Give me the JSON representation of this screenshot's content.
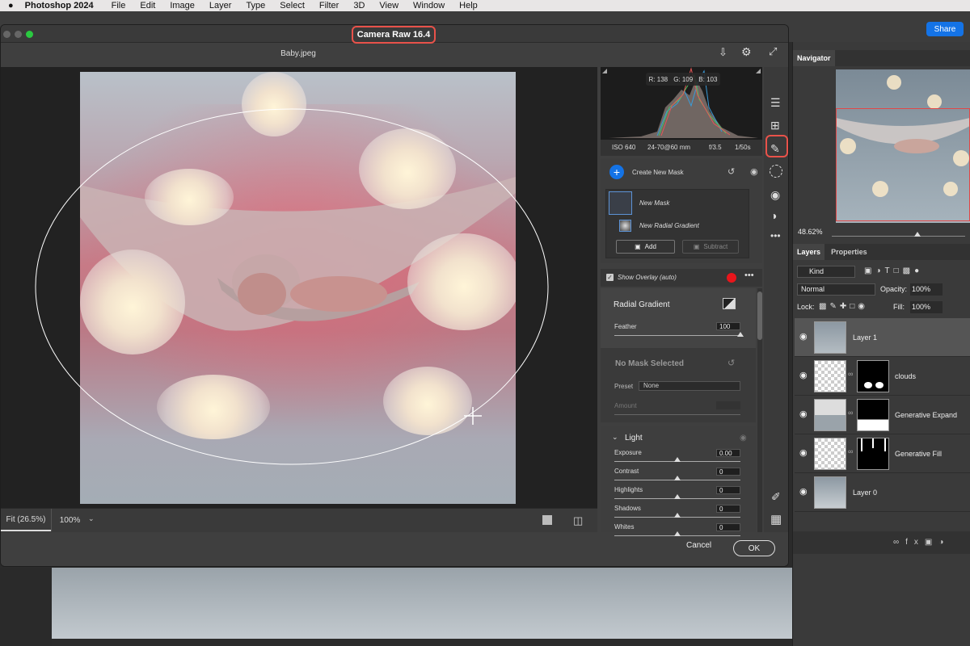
{
  "menubar": {
    "app": "Photoshop 2024",
    "items": [
      "File",
      "Edit",
      "Image",
      "Layer",
      "Type",
      "Select",
      "Filter",
      "3D",
      "View",
      "Window",
      "Help"
    ]
  },
  "share_label": "Share",
  "dialog": {
    "title": "Camera Raw 16.4",
    "filename": "Baby.jpeg",
    "zoom_fit": "Fit (26.5%)",
    "zoom_pct": "100%",
    "cancel": "Cancel",
    "ok": "OK"
  },
  "histogram": {
    "r": "R: 138",
    "g": "G: 109",
    "b": "B: 103"
  },
  "exif": {
    "iso": "ISO 640",
    "lens": "24-70@60 mm",
    "aperture": "f/3.5",
    "shutter": "1/50s"
  },
  "masking": {
    "create_label": "Create New Mask",
    "new_mask": "New Mask",
    "radial": "New Radial Gradient",
    "add": "Add",
    "subtract": "Subtract",
    "show_overlay": "Show Overlay (auto)",
    "overlay_color": "#e8151b"
  },
  "radial_panel": {
    "title": "Radial Gradient",
    "feather_label": "Feather",
    "feather_value": "100",
    "feather_pct": 100
  },
  "no_mask": {
    "title": "No Mask Selected",
    "preset_label": "Preset",
    "preset_value": "None",
    "amount_label": "Amount"
  },
  "light": {
    "title": "Light",
    "sliders": [
      {
        "label": "Exposure",
        "value": "0.00"
      },
      {
        "label": "Contrast",
        "value": "0"
      },
      {
        "label": "Highlights",
        "value": "0"
      },
      {
        "label": "Shadows",
        "value": "0"
      },
      {
        "label": "Whites",
        "value": "0"
      }
    ]
  },
  "navigator": {
    "tab": "Navigator",
    "zoom": "48.62%"
  },
  "layers_panel": {
    "tabs": [
      "Layers",
      "Properties"
    ],
    "kind": "Kind",
    "blend": "Normal",
    "opacity_label": "Opacity:",
    "opacity": "100%",
    "lock_label": "Lock:",
    "fill_label": "Fill:",
    "fill": "100%",
    "layers": [
      "Layer 1",
      "clouds",
      "Generative Expand",
      "Generative Fill",
      "Layer 0"
    ]
  }
}
